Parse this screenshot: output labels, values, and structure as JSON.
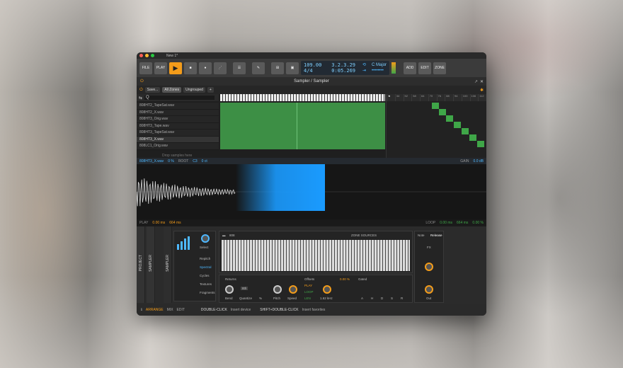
{
  "window": {
    "title": "New 1*"
  },
  "toolbar": {
    "file": "FILE",
    "play_label": "PLAY",
    "add": "ADD",
    "edit": "EDIT",
    "zone": "ZONE",
    "tempo": "109.00",
    "signature": "4/4",
    "position": "3.2.3.29",
    "time": "0:05.269",
    "key": "C Major"
  },
  "device": {
    "title": "Sampler / Sampler"
  },
  "zones": {
    "save": "Save...",
    "all_zones": "All Zones",
    "ungrouped": "Ungrouped",
    "add": "+",
    "search_value": "Q",
    "items": [
      "808HT2_TapeSat.wav",
      "808HT2_X.wav",
      "808HT3_Orig.wav",
      "808HT3_Tape.wav",
      "808HT3_TapeSat.wav",
      "808HT3_X.wav",
      "808LC1_Orig.wav"
    ],
    "drop_text": "Drop samples here",
    "ruler": [
      "34",
      "52",
      "58",
      "64",
      "70",
      "76",
      "88",
      "94",
      "100",
      "106",
      "112"
    ]
  },
  "sample": {
    "name": "808HT3_X.wav",
    "fine": "0 %",
    "root_label": "ROOT",
    "root": "C3",
    "cents": "0 ct",
    "gain_label": "GAIN",
    "gain": "0.0 dB"
  },
  "wavebar": {
    "play": "PLAY",
    "start": "0.00 ms",
    "end": "664 ms",
    "loop": "LOOP",
    "loop_start": "0.00 ms",
    "loop_end": "664 ms",
    "xfade": "0.00 %"
  },
  "strips": {
    "project": "PROJECT",
    "sampler": "SAMPLER",
    "sampler2": "SAMPLER"
  },
  "modes": {
    "select": "Select",
    "items": [
      "Repitch",
      "Spectral",
      "Cycles",
      "Textures",
      "Fragments"
    ]
  },
  "zone_panel": {
    "name": "808",
    "sources": "ZONE SOURCES"
  },
  "controls": {
    "returns": "Returns",
    "bend": "Bend",
    "quantize": "Quantize",
    "quantize_val": "8th",
    "percent": "%",
    "pitch": "Pitch",
    "speed": "Speed",
    "offsets": "Offsets",
    "play": "PLAY",
    "loop": "LOOP",
    "len": "LEN",
    "cutoff": "1.62 kHz",
    "gain_pct": "0.00 %",
    "gated": "Gated",
    "adsr": [
      "A",
      "H",
      "D",
      "S",
      "R"
    ],
    "note": "Note",
    "release": "Release",
    "fx": "FX",
    "out": "Out"
  },
  "status": {
    "arrange": "ARRANGE",
    "mix": "MIX",
    "edit": "EDIT",
    "hint1_key": "DOUBLE-CLICK",
    "hint1": "Insert device",
    "hint2_key": "SHIFT+DOUBLE-CLICK",
    "hint2": "Insert favorites"
  },
  "colors": {
    "accent": "#f39c1a",
    "blue": "#4db8ff",
    "green": "#3d8f45"
  }
}
